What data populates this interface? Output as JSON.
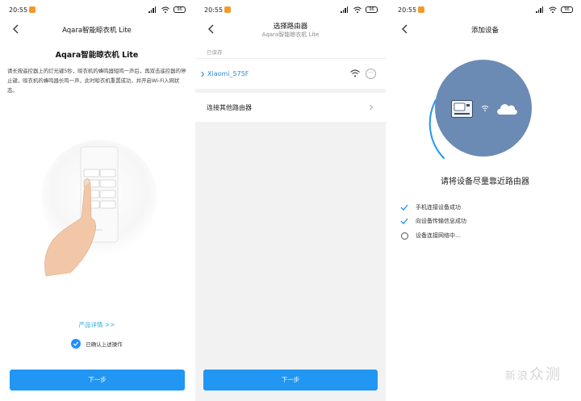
{
  "status": {
    "time": "20:55",
    "battery": "96"
  },
  "screen1": {
    "title": "Aqara智能晾衣机 Lite",
    "heading": "Aqara智能晾衣机 Lite",
    "instructions": "请长按遥控器上的灯光键5秒，晾衣机的蜂鸣器短鸣一声后，再双击遥控器的停止键，晾衣机的蜂鸣器长鸣一声，此时晾衣机重置成功，并开启Wi-Fi入网状态。",
    "product_link": "产品详情 >>",
    "confirm_label": "已确认上述操作",
    "confirm_checked": true,
    "next_label": "下一步"
  },
  "screen2": {
    "title": "选择路由器",
    "subtitle": "Aqara智能晾衣机 Lite",
    "saved_label": "已保存",
    "network_name": "Xiaomi_575F",
    "other_label": "连接其他路由器",
    "next_label": "下一步"
  },
  "screen3": {
    "title": "添加设备",
    "heading": "请将设备尽量靠近路由器",
    "steps": [
      {
        "label": "手机连接设备成功",
        "state": "done"
      },
      {
        "label": "向设备传输信息成功",
        "state": "done"
      },
      {
        "label": "设备连接网络中…",
        "state": "pending"
      }
    ]
  },
  "colors": {
    "accent": "#2196f3",
    "link": "#2ba9d9",
    "hero": "#6b8bb5"
  },
  "watermark": {
    "big": "新",
    "small": "浪",
    "rest": "众测"
  }
}
